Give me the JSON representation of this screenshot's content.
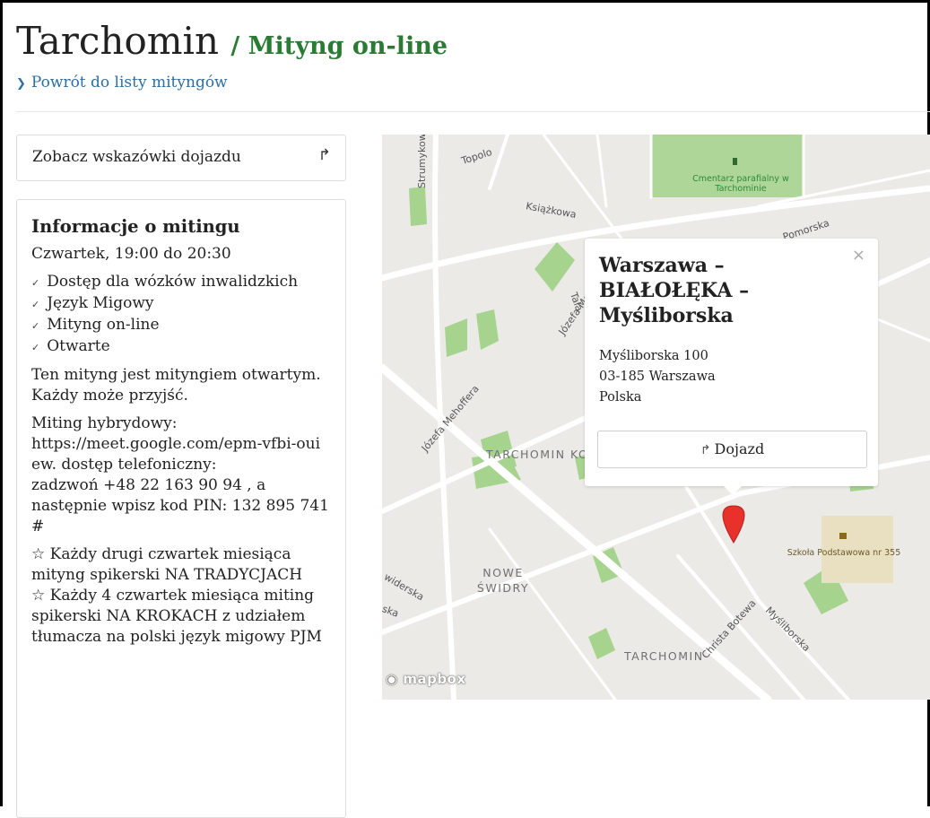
{
  "header": {
    "title": "Tarchomin",
    "subtitle": "/ Mityng on-line",
    "back_link": "Powrót do listy mityngów"
  },
  "directions": {
    "label": "Zobacz wskazówki dojazdu",
    "icon": "share-arrow-icon"
  },
  "info": {
    "heading": "Informacje o mitingu",
    "time": "Czwartek, 19:00 do 20:30",
    "features": [
      "Dostęp dla wózków inwalidzkich",
      "Język Migowy",
      "Mityng on-line",
      "Otwarte"
    ],
    "open_note": "Ten mityng jest mityngiem otwartym. Każdy może przyjść.",
    "hybrid_lines": [
      "Miting hybrydowy:",
      "https://meet.google.com/epm-vfbi-oui",
      "ew. dostęp telefoniczny:",
      "zadzwoń +48 22 163 90 94 , a następnie wpisz kod PIN: 132 895 741 #"
    ],
    "schedule_lines": [
      "☆ Każdy drugi czwartek miesiąca mityng spikerski NA TRADYCJACH",
      "☆ Każdy 4 czwartek miesiąca miting spikerski NA KROKACH z udziałem tłumacza na polski język migowy PJM"
    ]
  },
  "popup": {
    "title": "Warszawa – BIAŁOŁĘKA – Myśliborska",
    "address_line1": "Myśliborska 100",
    "address_line2": "03-185 Warszawa",
    "address_line3": "Polska",
    "button_label": "Dojazd",
    "close": "×"
  },
  "map": {
    "streets": [
      "Topolo",
      "Strumykowa",
      "Książkowa",
      "Pomorska",
      "Józefa Mehoffera",
      "Józefa Mehoffera",
      "Tala",
      "Christa Botewa",
      "Myśliborska",
      "widerska",
      "ska"
    ],
    "districts": [
      "TARCHOMIN KOŚCIELNY",
      "NOWE ŚWIDRY",
      "TARCHOMIN"
    ],
    "poi": [
      "Cmentarz parafialny w Tarchominie",
      "Szkoła Podstawowa nr 355"
    ],
    "attribution": "mapbox",
    "colors": {
      "park": "#a6d48f",
      "road": "#ffffff",
      "background": "#ebeae6",
      "marker": "#e8312a"
    }
  }
}
